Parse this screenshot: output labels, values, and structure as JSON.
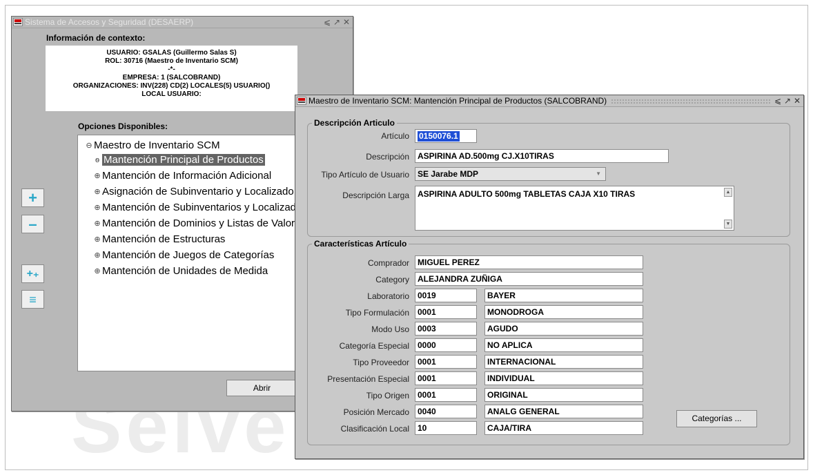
{
  "watermark": "Selvel",
  "win1": {
    "title": "Sistema de Accesos y Seguridad (DESAERP)",
    "controls": [
      "⩽",
      "↗",
      "✕"
    ],
    "context_heading": "Información de contexto:",
    "context_lines": [
      "USUARIO: GSALAS (Guillermo Salas S)",
      "ROL: 30716 (Maestro de Inventario SCM)",
      "-*-",
      "EMPRESA: 1 (SALCOBRAND)",
      "ORGANIZACIONES: INV(228) CD(2) LOCALES(5) USUARIO()",
      "LOCAL USUARIO:"
    ],
    "options_heading": "Opciones Disponibles:",
    "tree_root": "Maestro de Inventario SCM",
    "tree_items": [
      {
        "label": "Mantención Principal de Productos",
        "selected": true,
        "toggle": "ѳ"
      },
      {
        "label": "Mantención de Información Adicional",
        "selected": false,
        "toggle": "⊕"
      },
      {
        "label": "Asignación de Subinventario y Localizado",
        "selected": false,
        "toggle": "⊕"
      },
      {
        "label": "Mantención de Subinventarios y Localizad",
        "selected": false,
        "toggle": "⊕"
      },
      {
        "label": "Mantención de Dominios y Listas de Valor",
        "selected": false,
        "toggle": "⊕"
      },
      {
        "label": "Mantención de Estructuras",
        "selected": false,
        "toggle": "⊕"
      },
      {
        "label": "Mantención de Juegos de Categorías",
        "selected": false,
        "toggle": "⊕"
      },
      {
        "label": "Mantención de Unidades de Medida",
        "selected": false,
        "toggle": "⊕"
      }
    ],
    "side_buttons": [
      {
        "name": "expand-button",
        "glyph": "+"
      },
      {
        "name": "collapse-button",
        "glyph": "–"
      },
      {
        "name": "expand-all-button",
        "glyph": "+₊"
      },
      {
        "name": "collapse-all-button",
        "glyph": "≡"
      }
    ],
    "open_button": "Abrir"
  },
  "win2": {
    "title": "Maestro de Inventario SCM: Mantención Principal de Productos (SALCOBRAND)",
    "controls": [
      "⩽",
      "↗",
      "✕"
    ],
    "section1_title": "Descripción Articulo",
    "articulo_label": "Artículo",
    "articulo_value": "0150076.1",
    "descripcion_label": "Descripción",
    "descripcion_value": "ASPIRINA AD.500mg CJ.X10TIRAS",
    "tipo_label": "Tipo Artículo de Usuario",
    "tipo_value": "SE Jarabe MDP",
    "desc_larga_label": "Descripción Larga",
    "desc_larga_value": "ASPIRINA ADULTO 500mg TABLETAS CAJA X10 TIRAS",
    "section2_title": "Características Artículo",
    "comprador_label": "Comprador",
    "comprador_value": "MIGUEL PEREZ",
    "category_label": "Category",
    "category_value": "ALEJANDRA ZUÑIGA",
    "rows": [
      {
        "label": "Laboratorio",
        "code": "0019",
        "desc": "BAYER"
      },
      {
        "label": "Tipo Formulación",
        "code": "0001",
        "desc": "MONODROGA"
      },
      {
        "label": "Modo Uso",
        "code": "0003",
        "desc": "AGUDO"
      },
      {
        "label": "Categoría Especial",
        "code": "0000",
        "desc": "NO APLICA"
      },
      {
        "label": "Tipo Proveedor",
        "code": "0001",
        "desc": "INTERNACIONAL"
      },
      {
        "label": "Presentación Especial",
        "code": "0001",
        "desc": "INDIVIDUAL"
      },
      {
        "label": "Tipo Origen",
        "code": "0001",
        "desc": "ORIGINAL"
      },
      {
        "label": "Posición Mercado",
        "code": "0040",
        "desc": "ANALG GENERAL"
      },
      {
        "label": "Clasificación Local",
        "code": "10",
        "desc": "CAJA/TIRA"
      }
    ],
    "categorias_button": "Categorías ..."
  }
}
